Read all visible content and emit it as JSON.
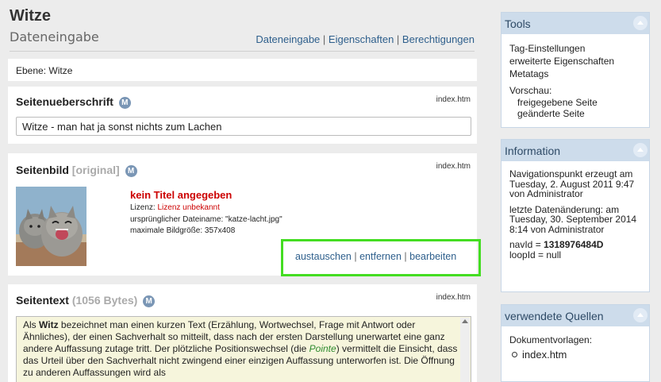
{
  "header": {
    "title": "Witze",
    "subtitle": "Dateneingabe",
    "tabs": [
      "Dateneingabe",
      "Eigenschaften",
      "Berechtigungen"
    ],
    "separator": " | "
  },
  "ebene": {
    "text": "Ebene: Witze"
  },
  "sections": {
    "heading": {
      "title": "Seitenueberschrift",
      "badge": "M",
      "file": "index.htm",
      "value": "Witze - man hat ja sonst nichts zum Lachen"
    },
    "image": {
      "title": "Seitenbild",
      "title_suffix": "[original]",
      "badge": "M",
      "file": "index.htm",
      "no_title": "kein Titel angegeben",
      "license_label": "Lizenz: ",
      "license_value": "Lizenz unbekannt",
      "filename_line": "ursprünglicher Dateiname: \"katze-lacht.jpg\"",
      "size_line": "maximale Bildgröße: 357x408",
      "actions": [
        "austauschen",
        "entfernen",
        "bearbeiten"
      ]
    },
    "text": {
      "title": "Seitentext",
      "title_suffix": "(1056 Bytes)",
      "badge": "M",
      "file": "index.htm",
      "body_1": "Als ",
      "body_bold": "Witz",
      "body_2": " bezeichnet man einen kurzen Text (Erzählung, Wortwechsel, Frage mit Antwort oder Ähnliches), der einen Sachverhalt so mitteilt, dass nach der ersten Darstellung unerwartet eine ganz andere Auffassung zutage tritt. Der plötzliche Positionswechsel (die ",
      "body_italic": "Pointe",
      "body_3": ") vermittelt die Einsicht, dass das Urteil über den Sachverhalt nicht zwingend einer einzigen Auffassung unterworfen ist. Die Öffnung zu anderen Auffassungen wird als"
    }
  },
  "sidebar": {
    "tools": {
      "title": "Tools",
      "items": [
        "Tag-Einstellungen",
        "erweiterte Eigenschaften",
        "Metatags"
      ],
      "preview_label": "Vorschau:",
      "preview_items": [
        "freigegebene Seite",
        "geänderte Seite"
      ]
    },
    "information": {
      "title": "Information",
      "nav_created": "Navigationspunkt erzeugt am Tuesday, 2. August 2011 9:47 von Administrator",
      "last_change": "letzte Datenänderung: am Tuesday, 30. September 2014 8:14 von Administrator",
      "navid_label": "navId = ",
      "navid_value": "1318976484D",
      "loopid": "loopId = null"
    },
    "sources": {
      "title": "verwendete Quellen",
      "label": "Dokumentvorlagen:",
      "items": [
        "index.htm"
      ]
    }
  },
  "colors": {
    "accent_link": "#2e5f8c",
    "highlight_border": "#44dd22",
    "error_red": "#cc0000",
    "sidebar_header": "#cddceb",
    "text_area_bg": "#f6f5dc"
  }
}
